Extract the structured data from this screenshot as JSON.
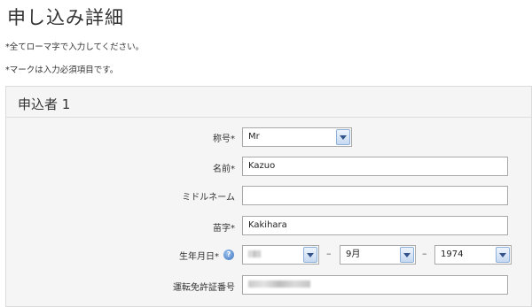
{
  "page": {
    "title": "申し込み詳細",
    "notes": [
      "*全てローマ字で入力してください。",
      "*マークは入力必須項目です。"
    ]
  },
  "applicant": {
    "section_title": "申込者 1",
    "title_label": "称号*",
    "title_value": "Mr",
    "first_name_label": "名前*",
    "first_name_value": "Kazuo",
    "middle_name_label": "ミドルネーム",
    "middle_name_value": "",
    "last_name_label": "苗字*",
    "last_name_value": "Kakihara",
    "dob_label": "生年月日*",
    "dob_day_value": "",
    "dob_month_value": "9月",
    "dob_year_value": "1974",
    "dob_separator": "–",
    "license_label": "運転免許証番号",
    "license_value": ""
  },
  "icons": {
    "help": "help-icon",
    "dropdown": "chevron-down-icon"
  },
  "colors": {
    "panel_bg": "#f5f5f5",
    "select_button": "#c6d9f1",
    "help_icon": "#3f76c0"
  }
}
